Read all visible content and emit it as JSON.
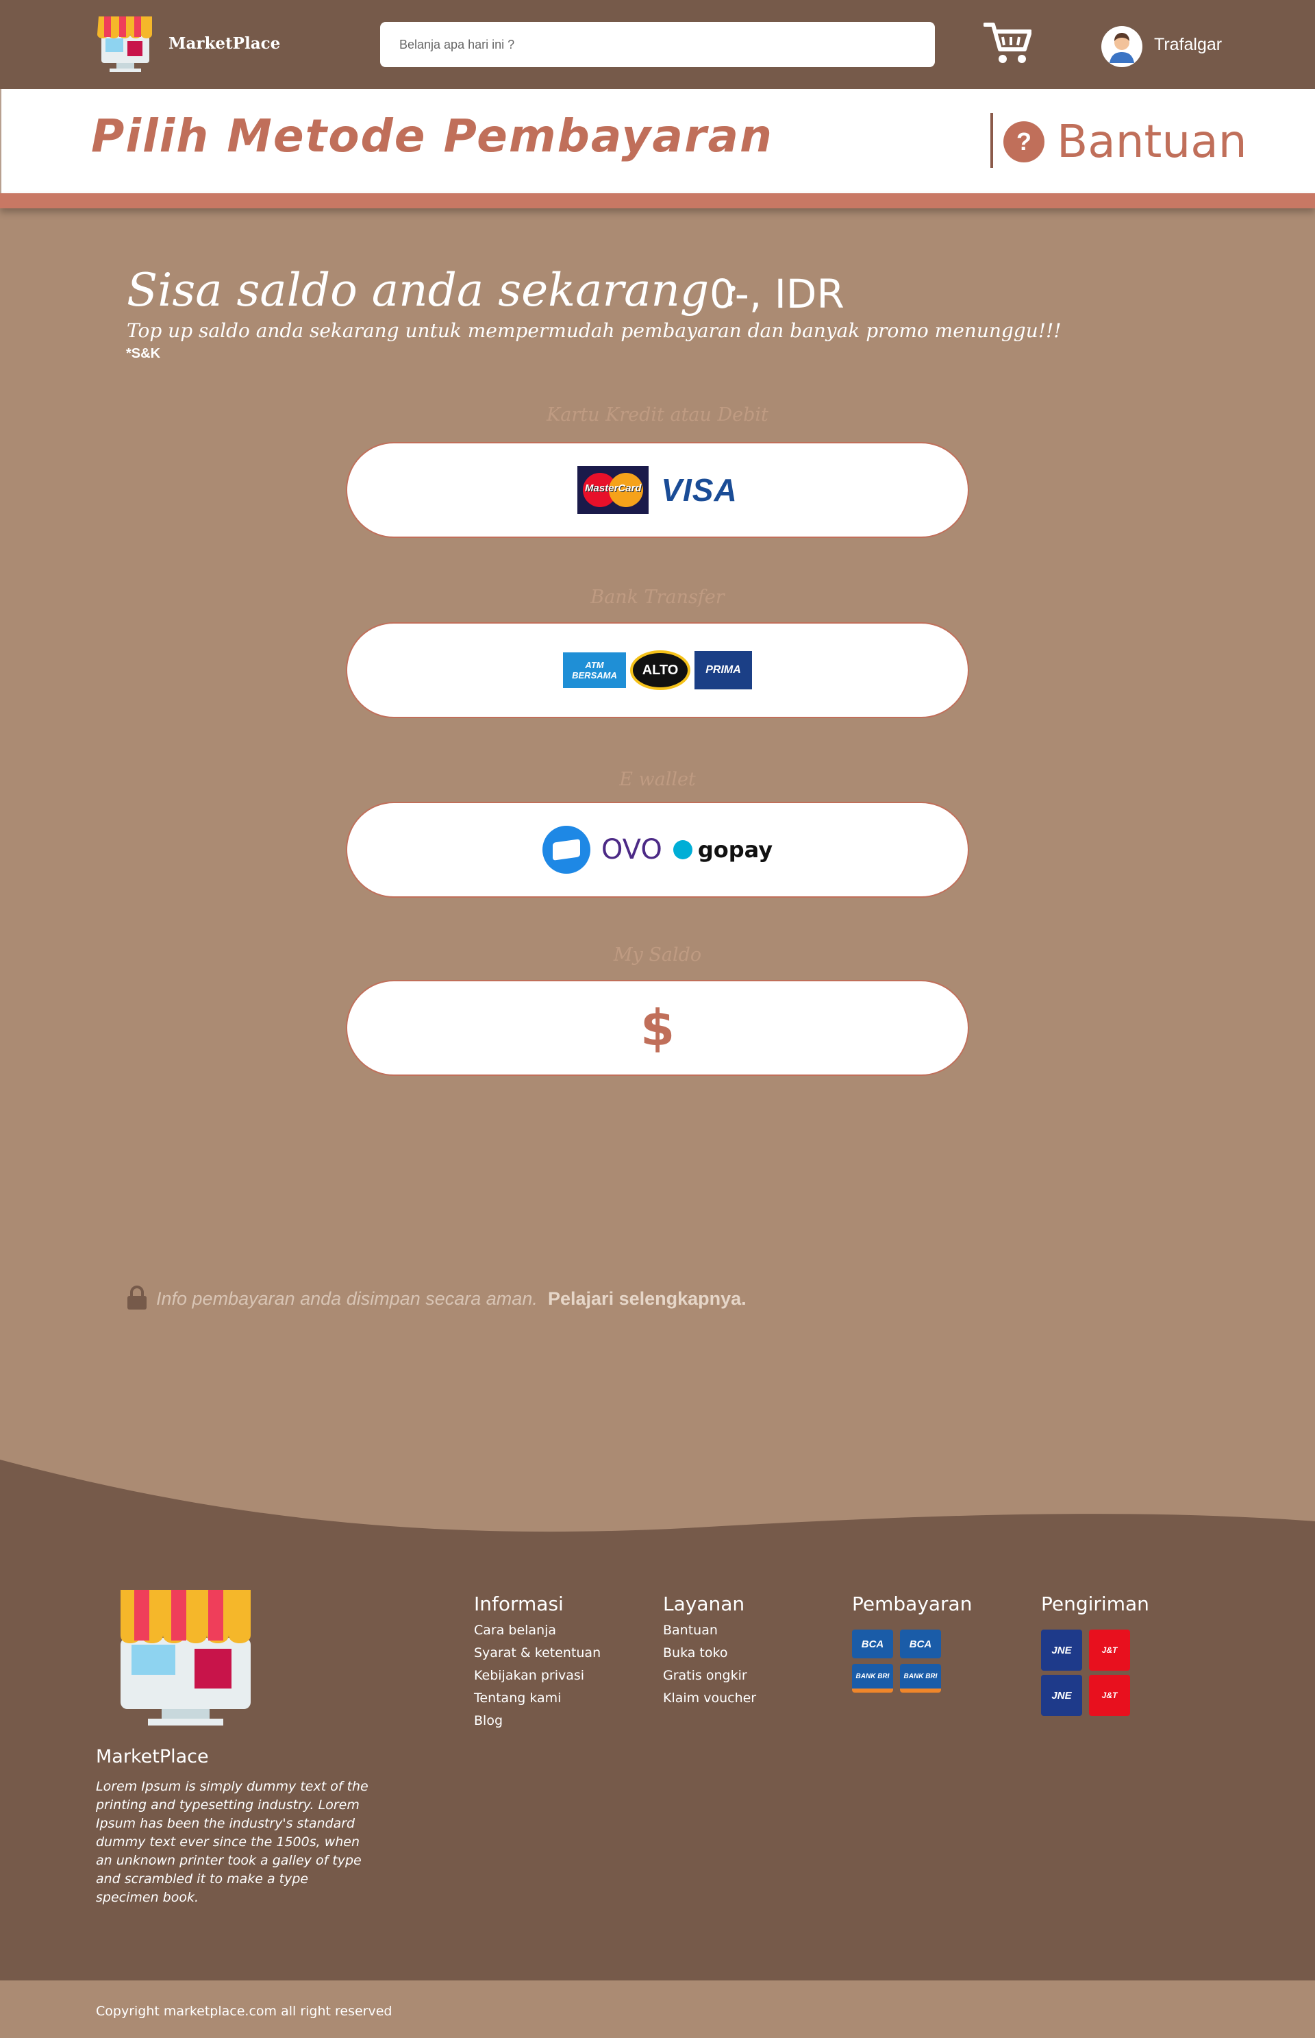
{
  "header": {
    "brand": "MarketPlace",
    "search_placeholder": "Belanja apa hari ini ?",
    "username": "Trafalgar"
  },
  "title_bar": {
    "title": "Pilih Metode Pembayaran",
    "help_label": "Bantuan",
    "help_glyph": "?"
  },
  "balance": {
    "label": "Sisa saldo anda sekarang :",
    "value": "0-, IDR",
    "promo": "Top up saldo anda sekarang untuk mempermudah pembayaran dan banyak promo menunggu!!!",
    "terms": "*S&K"
  },
  "payment_methods": [
    {
      "label": "Kartu Kredit atau Debit",
      "logos": [
        "MasterCard",
        "VISA"
      ]
    },
    {
      "label": "Bank Transfer",
      "logos": [
        "ATM BERSAMA",
        "ALTO",
        "PRIMA"
      ]
    },
    {
      "label": "E wallet",
      "logos": [
        "OVO",
        "gopay"
      ]
    },
    {
      "label": "My Saldo",
      "logos": [
        "$"
      ]
    }
  ],
  "secure_info": {
    "text": "Info pembayaran anda disimpan secara aman.",
    "link": "Pelajari selengkapnya."
  },
  "footer": {
    "brand": "MarketPlace",
    "description": "Lorem Ipsum is simply dummy text of the printing and typesetting industry. Lorem Ipsum has been the industry's standard dummy text ever since the 1500s, when an unknown printer took a galley of type and scrambled it to make a type specimen book.",
    "columns": [
      {
        "title": "Informasi",
        "links": [
          "Cara belanja",
          "Syarat & ketentuan",
          "Kebijakan privasi",
          "Tentang kami",
          "Blog"
        ]
      },
      {
        "title": "Layanan",
        "links": [
          "Bantuan",
          "Buka toko",
          "Gratis ongkir",
          "Klaim voucher"
        ]
      }
    ],
    "payment_title": "Pembayaran",
    "payment_badges": [
      "BCA",
      "BCA",
      "BANK BRI",
      "BANK BRI"
    ],
    "shipping_title": "Pengiriman",
    "shipping_badges": [
      "JNE",
      "J&T",
      "JNE",
      "J&T"
    ],
    "copyright": "Copyright marketplace.com all right reserved"
  },
  "colors": {
    "header_bg": "#765a4a",
    "page_bg": "#ab8b73",
    "accent": "#c06f5a"
  }
}
